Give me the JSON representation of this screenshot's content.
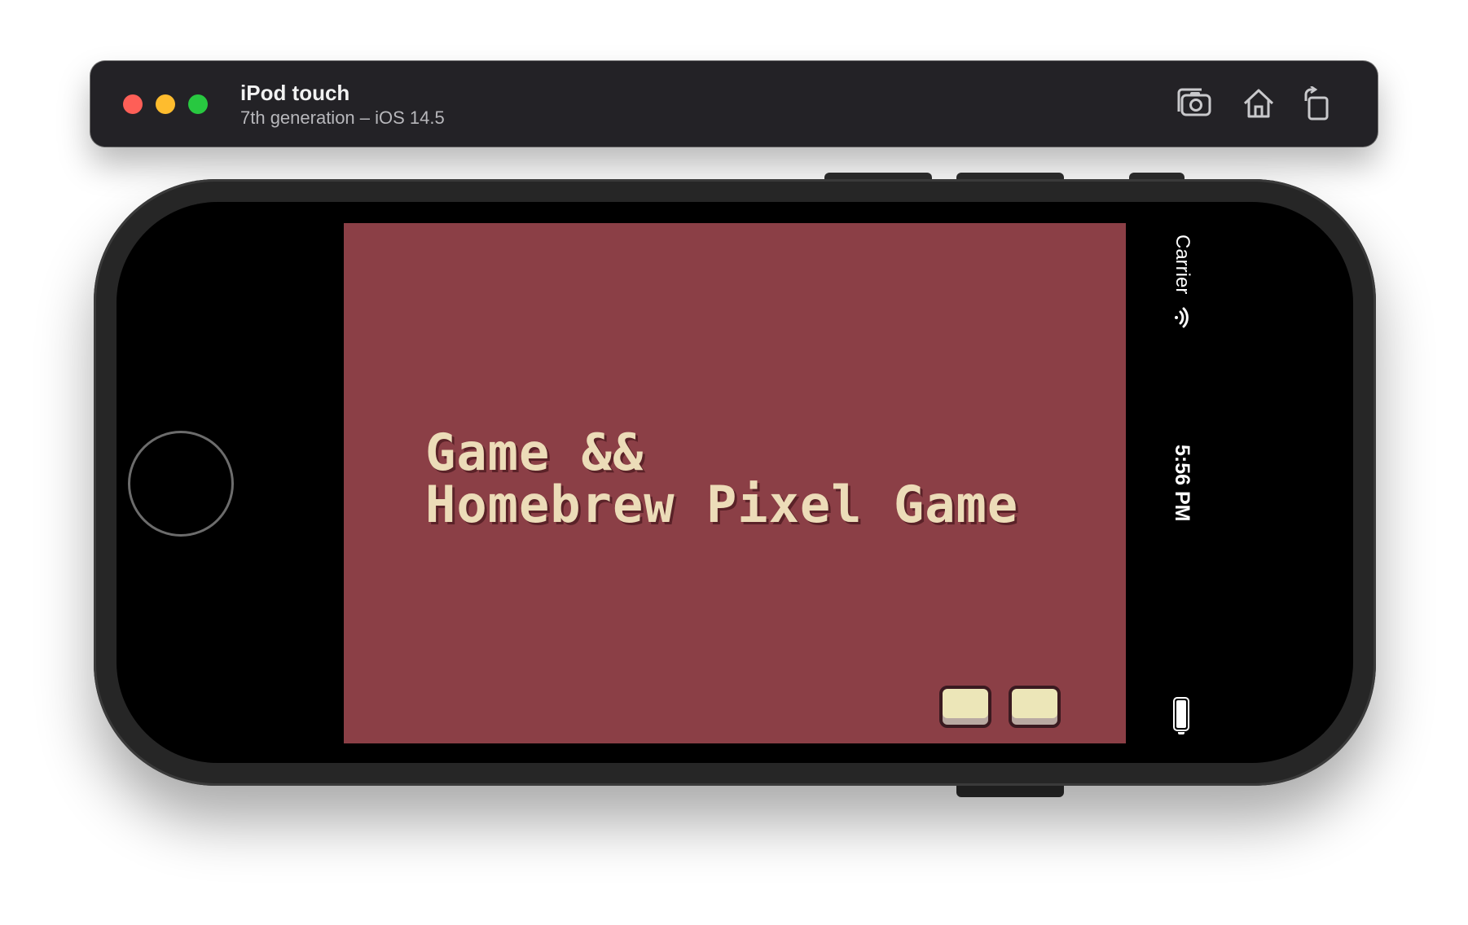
{
  "window": {
    "device_name": "iPod touch",
    "device_subtitle": "7th generation – iOS 14.5",
    "toolbar_icons": [
      "screenshot-icon",
      "home-icon",
      "rotate-icon"
    ]
  },
  "status_bar": {
    "carrier": "Carrier",
    "time": "5:56 PM",
    "icons": [
      "wifi-icon",
      "battery-icon"
    ]
  },
  "game": {
    "title_line1": "Game &&",
    "title_line2": "Homebrew Pixel Game",
    "background_color": "#8b3f46",
    "text_color": "#ecdcb8",
    "buttons": [
      "button-a",
      "button-b"
    ]
  }
}
